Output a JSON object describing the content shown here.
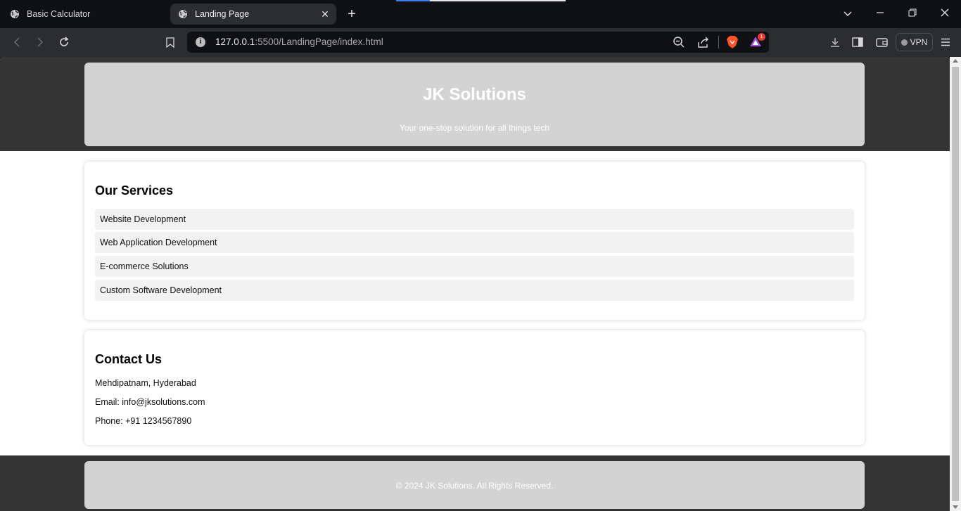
{
  "browser": {
    "tabs": [
      {
        "label": "Basic Calculator",
        "active": false
      },
      {
        "label": "Landing Page",
        "active": true
      }
    ],
    "url_host": "127.0.0.1",
    "url_path": ":5500/LandingPage/index.html",
    "vpn_label": "VPN",
    "shield_count": "1"
  },
  "header": {
    "title": "JK Solutions",
    "tagline": "Your one-stop solution for all things tech"
  },
  "services": {
    "heading": "Our Services",
    "items": [
      "Website Development",
      "Web Application Development",
      "E-commerce Solutions",
      "Custom Software Development"
    ]
  },
  "contact": {
    "heading": "Contact Us",
    "address": "Mehdipatnam, Hyderabad",
    "email": "Email: info@jksolutions.com",
    "phone": "Phone: +91 1234567890"
  },
  "footer": {
    "text": "© 2024 JK Solutions. All Rights Reserved."
  },
  "colors": {
    "header_band": "#333333",
    "header_card": "#d3d3d3",
    "service_item_bg": "#f2f2f2"
  }
}
